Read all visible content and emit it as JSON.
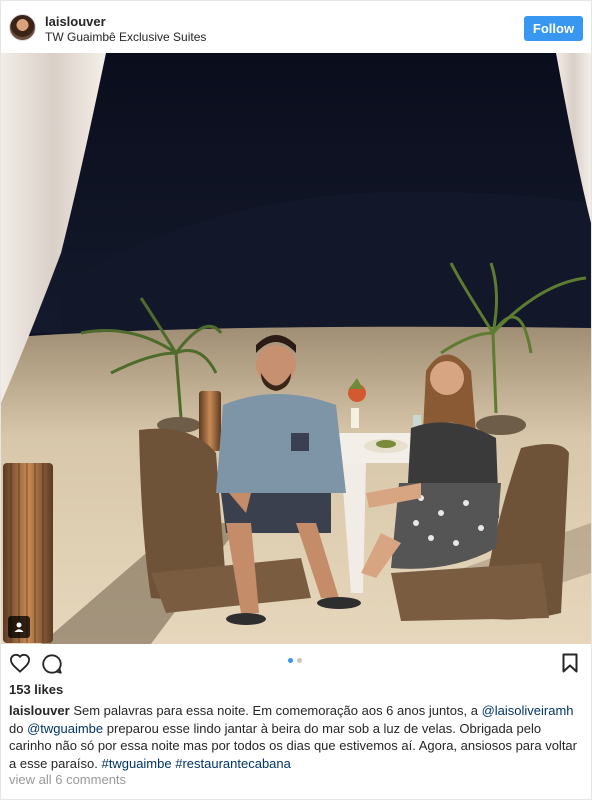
{
  "post": {
    "username": "laislouver",
    "location": "TW Guaimbê Exclusive Suites",
    "follow_label": "Follow",
    "likes": "153 likes",
    "carousel": {
      "count": 2,
      "active_index": 0
    },
    "caption": {
      "author": "laislouver",
      "text1": " Sem palavras para essa noite. Em comemoração aos 6 anos juntos, a ",
      "mention1": "@laisoliveiramh",
      "text2": " do ",
      "mention2": "@twguaimbe",
      "text3": " preparou esse lindo jantar à beira do mar sob a luz de velas. Obrigada pelo carinho não só por essa noite mas por todos os dias que estivemos aí. Agora, ansiosos para voltar a esse paraíso. ",
      "hashtag1": "#twguaimbe",
      "text4": " ",
      "hashtag2": "#restaurantecabana"
    },
    "view_comments": "view all 6 comments"
  },
  "icons": {
    "avatar": "avatar",
    "like": "heart-icon",
    "comment": "comment-icon",
    "save": "bookmark-icon",
    "user_tags": "person-icon"
  },
  "colors": {
    "follow_button": "#3897f0",
    "mention": "#003569",
    "muted_text": "#999999",
    "active_dot": "#3897f0",
    "inactive_dot": "#c7c7c7"
  }
}
